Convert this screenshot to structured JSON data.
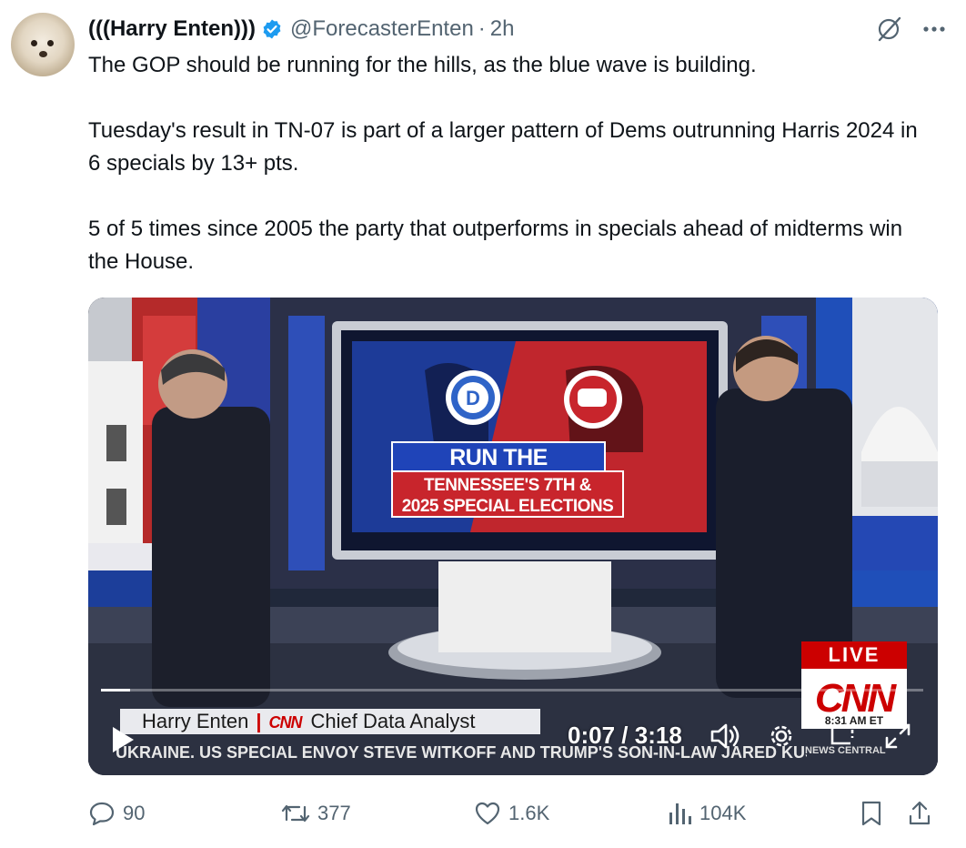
{
  "tweet": {
    "display_name": "(((Harry Enten)))",
    "handle": "@ForecasterEnten",
    "separator": "·",
    "time": "2h",
    "text": "The GOP should be running for the hills, as the blue wave is building.\n\nTuesday's result in TN-07 is part of a larger pattern of Dems outrunning Harris 2024 in 6 specials by 13+ pts.\n\n5 of 5 times since 2005 the party that outperforms in specials ahead of midterms win the House."
  },
  "video": {
    "screen_title": "RUN THE NUMBERS",
    "screen_subtitle": "TENNESSEE'S 7TH &\n2025 SPECIAL ELECTIONS",
    "lower_third_name": "Harry Enten",
    "lower_third_network": "CNN",
    "lower_third_role": "Chief Data Analyst",
    "ticker": "UKRAINE. US SPECIAL ENVOY STEVE WITKOFF AND TRUMP'S SON-IN-LAW JARED KUS",
    "live_label": "LIVE",
    "network_logo": "CNN",
    "clock": "8:31 AM ET",
    "news_central": "NEWS CENTRAL",
    "current_time": "0:07",
    "time_separator": "/",
    "duration": "3:18",
    "progress_fraction": 0.035
  },
  "actions": {
    "replies": "90",
    "reposts": "377",
    "likes": "1.6K",
    "views": "104K"
  },
  "icons": [
    "verified-badge-icon",
    "grok-icon",
    "more-icon",
    "play-icon",
    "volume-icon",
    "settings-icon",
    "pip-icon",
    "fullscreen-icon",
    "reply-icon",
    "repost-icon",
    "like-icon",
    "views-icon",
    "bookmark-icon",
    "share-icon"
  ],
  "colors": {
    "verified": "#1d9bf0",
    "secondary_text": "#536471",
    "cnn_red": "#cc0000"
  }
}
